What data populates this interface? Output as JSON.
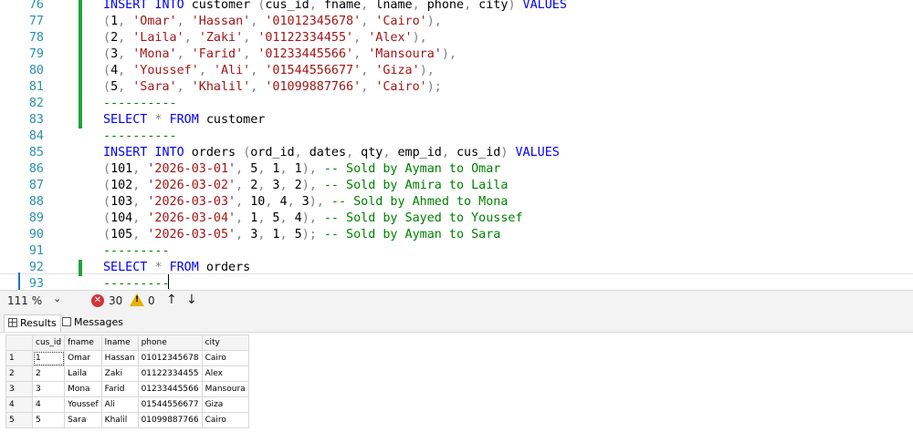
{
  "editor": {
    "lines": [
      {
        "n": "76",
        "marker": true,
        "tokens": [
          {
            "t": "INSERT INTO",
            "c": "kw"
          },
          {
            "t": " customer "
          },
          {
            "t": "(",
            "c": "op"
          },
          {
            "t": "cus_id"
          },
          {
            "t": ",",
            "c": "op"
          },
          {
            "t": " fname"
          },
          {
            "t": ",",
            "c": "op"
          },
          {
            "t": " lname"
          },
          {
            "t": ",",
            "c": "op"
          },
          {
            "t": " phone"
          },
          {
            "t": ",",
            "c": "op"
          },
          {
            "t": " city"
          },
          {
            "t": ")",
            "c": "op"
          },
          {
            "t": " VALUES",
            "c": "kw"
          }
        ]
      },
      {
        "n": "77",
        "marker": true,
        "tokens": [
          {
            "t": "(",
            "c": "op"
          },
          {
            "t": "1"
          },
          {
            "t": ",",
            "c": "op"
          },
          {
            "t": " "
          },
          {
            "t": "'Omar'",
            "c": "str"
          },
          {
            "t": ",",
            "c": "op"
          },
          {
            "t": " "
          },
          {
            "t": "'Hassan'",
            "c": "str"
          },
          {
            "t": ",",
            "c": "op"
          },
          {
            "t": " "
          },
          {
            "t": "'01012345678'",
            "c": "str"
          },
          {
            "t": ",",
            "c": "op"
          },
          {
            "t": " "
          },
          {
            "t": "'Cairo'",
            "c": "str"
          },
          {
            "t": "),",
            "c": "op"
          }
        ]
      },
      {
        "n": "78",
        "marker": true,
        "tokens": [
          {
            "t": "(",
            "c": "op"
          },
          {
            "t": "2"
          },
          {
            "t": ",",
            "c": "op"
          },
          {
            "t": " "
          },
          {
            "t": "'Laila'",
            "c": "str"
          },
          {
            "t": ",",
            "c": "op"
          },
          {
            "t": " "
          },
          {
            "t": "'Zaki'",
            "c": "str"
          },
          {
            "t": ",",
            "c": "op"
          },
          {
            "t": " "
          },
          {
            "t": "'01122334455'",
            "c": "str"
          },
          {
            "t": ",",
            "c": "op"
          },
          {
            "t": " "
          },
          {
            "t": "'Alex'",
            "c": "str"
          },
          {
            "t": "),",
            "c": "op"
          }
        ]
      },
      {
        "n": "79",
        "marker": true,
        "tokens": [
          {
            "t": "(",
            "c": "op"
          },
          {
            "t": "3"
          },
          {
            "t": ",",
            "c": "op"
          },
          {
            "t": " "
          },
          {
            "t": "'Mona'",
            "c": "str"
          },
          {
            "t": ",",
            "c": "op"
          },
          {
            "t": " "
          },
          {
            "t": "'Farid'",
            "c": "str"
          },
          {
            "t": ",",
            "c": "op"
          },
          {
            "t": " "
          },
          {
            "t": "'01233445566'",
            "c": "str"
          },
          {
            "t": ",",
            "c": "op"
          },
          {
            "t": " "
          },
          {
            "t": "'Mansoura'",
            "c": "str"
          },
          {
            "t": "),",
            "c": "op"
          }
        ]
      },
      {
        "n": "80",
        "marker": true,
        "tokens": [
          {
            "t": "(",
            "c": "op"
          },
          {
            "t": "4"
          },
          {
            "t": ",",
            "c": "op"
          },
          {
            "t": " "
          },
          {
            "t": "'Youssef'",
            "c": "str"
          },
          {
            "t": ",",
            "c": "op"
          },
          {
            "t": " "
          },
          {
            "t": "'Ali'",
            "c": "str"
          },
          {
            "t": ",",
            "c": "op"
          },
          {
            "t": " "
          },
          {
            "t": "'01544556677'",
            "c": "str"
          },
          {
            "t": ",",
            "c": "op"
          },
          {
            "t": " "
          },
          {
            "t": "'Giza'",
            "c": "str"
          },
          {
            "t": "),",
            "c": "op"
          }
        ]
      },
      {
        "n": "81",
        "marker": true,
        "tokens": [
          {
            "t": "(",
            "c": "op"
          },
          {
            "t": "5"
          },
          {
            "t": ",",
            "c": "op"
          },
          {
            "t": " "
          },
          {
            "t": "'Sara'",
            "c": "str"
          },
          {
            "t": ",",
            "c": "op"
          },
          {
            "t": " "
          },
          {
            "t": "'Khalil'",
            "c": "str"
          },
          {
            "t": ",",
            "c": "op"
          },
          {
            "t": " "
          },
          {
            "t": "'01099887766'",
            "c": "str"
          },
          {
            "t": ",",
            "c": "op"
          },
          {
            "t": " "
          },
          {
            "t": "'Cairo'",
            "c": "str"
          },
          {
            "t": ");",
            "c": "op"
          }
        ]
      },
      {
        "n": "82",
        "marker": true,
        "tokens": [
          {
            "t": "----------",
            "c": "cm"
          }
        ]
      },
      {
        "n": "83",
        "marker": true,
        "tokens": [
          {
            "t": "SELECT",
            "c": "kw"
          },
          {
            "t": " "
          },
          {
            "t": "*",
            "c": "op"
          },
          {
            "t": " "
          },
          {
            "t": "FROM",
            "c": "kw"
          },
          {
            "t": " customer"
          }
        ]
      },
      {
        "n": "84",
        "marker": false,
        "tokens": [
          {
            "t": "----------",
            "c": "cm"
          }
        ]
      },
      {
        "n": "85",
        "marker": false,
        "tokens": [
          {
            "t": "INSERT INTO",
            "c": "kw"
          },
          {
            "t": " orders "
          },
          {
            "t": "(",
            "c": "op"
          },
          {
            "t": "ord_id"
          },
          {
            "t": ",",
            "c": "op"
          },
          {
            "t": " dates"
          },
          {
            "t": ",",
            "c": "op"
          },
          {
            "t": " qty"
          },
          {
            "t": ",",
            "c": "op"
          },
          {
            "t": " emp_id"
          },
          {
            "t": ",",
            "c": "op"
          },
          {
            "t": " cus_id"
          },
          {
            "t": ")",
            "c": "op"
          },
          {
            "t": " VALUES",
            "c": "kw"
          }
        ]
      },
      {
        "n": "86",
        "marker": false,
        "tokens": [
          {
            "t": "(",
            "c": "op"
          },
          {
            "t": "101"
          },
          {
            "t": ",",
            "c": "op"
          },
          {
            "t": " "
          },
          {
            "t": "'2026-03-01'",
            "c": "str"
          },
          {
            "t": ",",
            "c": "op"
          },
          {
            "t": " 5"
          },
          {
            "t": ",",
            "c": "op"
          },
          {
            "t": " 1"
          },
          {
            "t": ",",
            "c": "op"
          },
          {
            "t": " 1"
          },
          {
            "t": "),",
            "c": "op"
          },
          {
            "t": " -- Sold by Ayman to Omar",
            "c": "cm"
          }
        ]
      },
      {
        "n": "87",
        "marker": false,
        "tokens": [
          {
            "t": "(",
            "c": "op"
          },
          {
            "t": "102"
          },
          {
            "t": ",",
            "c": "op"
          },
          {
            "t": " "
          },
          {
            "t": "'2026-03-02'",
            "c": "str"
          },
          {
            "t": ",",
            "c": "op"
          },
          {
            "t": " 2"
          },
          {
            "t": ",",
            "c": "op"
          },
          {
            "t": " 3"
          },
          {
            "t": ",",
            "c": "op"
          },
          {
            "t": " 2"
          },
          {
            "t": "),",
            "c": "op"
          },
          {
            "t": " -- Sold by Amira to Laila",
            "c": "cm"
          }
        ]
      },
      {
        "n": "88",
        "marker": false,
        "tokens": [
          {
            "t": "(",
            "c": "op"
          },
          {
            "t": "103"
          },
          {
            "t": ",",
            "c": "op"
          },
          {
            "t": " "
          },
          {
            "t": "'2026-03-03'",
            "c": "str"
          },
          {
            "t": ",",
            "c": "op"
          },
          {
            "t": " 10"
          },
          {
            "t": ",",
            "c": "op"
          },
          {
            "t": " 4"
          },
          {
            "t": ",",
            "c": "op"
          },
          {
            "t": " 3"
          },
          {
            "t": "),",
            "c": "op"
          },
          {
            "t": " -- Sold by Ahmed to Mona",
            "c": "cm"
          }
        ]
      },
      {
        "n": "89",
        "marker": false,
        "tokens": [
          {
            "t": "(",
            "c": "op"
          },
          {
            "t": "104"
          },
          {
            "t": ",",
            "c": "op"
          },
          {
            "t": " "
          },
          {
            "t": "'2026-03-04'",
            "c": "str"
          },
          {
            "t": ",",
            "c": "op"
          },
          {
            "t": " 1"
          },
          {
            "t": ",",
            "c": "op"
          },
          {
            "t": " 5"
          },
          {
            "t": ",",
            "c": "op"
          },
          {
            "t": " 4"
          },
          {
            "t": "),",
            "c": "op"
          },
          {
            "t": " -- Sold by Sayed to Youssef",
            "c": "cm"
          }
        ]
      },
      {
        "n": "90",
        "marker": false,
        "tokens": [
          {
            "t": "(",
            "c": "op"
          },
          {
            "t": "105"
          },
          {
            "t": ",",
            "c": "op"
          },
          {
            "t": " "
          },
          {
            "t": "'2026-03-05'",
            "c": "str"
          },
          {
            "t": ",",
            "c": "op"
          },
          {
            "t": " 3"
          },
          {
            "t": ",",
            "c": "op"
          },
          {
            "t": " 1"
          },
          {
            "t": ",",
            "c": "op"
          },
          {
            "t": " 5"
          },
          {
            "t": ");",
            "c": "op"
          },
          {
            "t": " -- Sold by Ayman to Sara",
            "c": "cm"
          }
        ]
      },
      {
        "n": "91",
        "marker": false,
        "tokens": [
          {
            "t": "---------",
            "c": "cm"
          }
        ]
      },
      {
        "n": "92",
        "marker": true,
        "tokens": [
          {
            "t": "SELECT",
            "c": "kw"
          },
          {
            "t": " "
          },
          {
            "t": "*",
            "c": "op"
          },
          {
            "t": " "
          },
          {
            "t": "FROM",
            "c": "kw"
          },
          {
            "t": " orders"
          }
        ]
      },
      {
        "n": "93",
        "marker": false,
        "tokens": [
          {
            "t": "---------",
            "c": "cm"
          }
        ]
      }
    ]
  },
  "status": {
    "zoom": "111 %",
    "errors": "30",
    "warnings": "0"
  },
  "tabs": {
    "results": "Results",
    "messages": "Messages"
  },
  "grid": {
    "columns": [
      "cus_id",
      "fname",
      "lname",
      "phone",
      "city"
    ],
    "rows": [
      {
        "num": "1",
        "cells": [
          "1",
          "Omar",
          "Hassan",
          "01012345678",
          "Cairo"
        ]
      },
      {
        "num": "2",
        "cells": [
          "2",
          "Laila",
          "Zaki",
          "01122334455",
          "Alex"
        ]
      },
      {
        "num": "3",
        "cells": [
          "3",
          "Mona",
          "Farid",
          "01233445566",
          "Mansoura"
        ]
      },
      {
        "num": "4",
        "cells": [
          "4",
          "Youssef",
          "Ali",
          "01544556677",
          "Giza"
        ]
      },
      {
        "num": "5",
        "cells": [
          "5",
          "Sara",
          "Khalil",
          "01099887766",
          "Cairo"
        ]
      }
    ]
  },
  "colors": {
    "keyword": "#0000ff",
    "string": "#a31515",
    "comment": "#008000",
    "line_number": "#2b91af",
    "change_marker": "#1fa33a"
  }
}
